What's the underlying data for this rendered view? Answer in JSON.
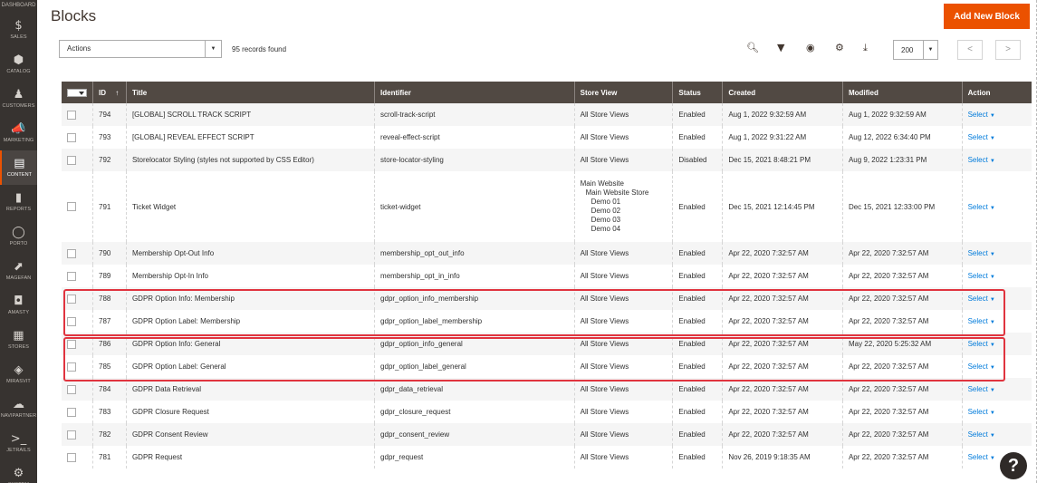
{
  "sidebar": {
    "top_label": "DASHBOARD",
    "items": [
      {
        "label": "SALES",
        "icon": "$",
        "active": false
      },
      {
        "label": "CATALOG",
        "icon": "⬢",
        "active": false
      },
      {
        "label": "CUSTOMERS",
        "icon": "♟",
        "active": false
      },
      {
        "label": "MARKETING",
        "icon": "📣",
        "active": false
      },
      {
        "label": "CONTENT",
        "icon": "▤",
        "active": true
      },
      {
        "label": "REPORTS",
        "icon": "▮",
        "active": false
      },
      {
        "label": "PORTO",
        "icon": "◯",
        "active": false
      },
      {
        "label": "MAGEFAN",
        "icon": "⬈",
        "active": false
      },
      {
        "label": "AMASTY",
        "icon": "◘",
        "active": false
      },
      {
        "label": "STORES",
        "icon": "▦",
        "active": false
      },
      {
        "label": "MIRASVIT",
        "icon": "◈",
        "active": false
      },
      {
        "label": "NAVIPARTNER",
        "icon": "☁",
        "active": false
      },
      {
        "label": "JETRAILS",
        "icon": ">_",
        "active": false
      },
      {
        "label": "SYSTEM",
        "icon": "⚙",
        "active": false
      }
    ]
  },
  "header": {
    "title": "Blocks",
    "add_button": "Add New Block"
  },
  "toolbar": {
    "actions_label": "Actions",
    "records_found": "95 records found",
    "per_page": "200"
  },
  "table": {
    "columns": [
      "ID",
      "Title",
      "Identifier",
      "Store View",
      "Status",
      "Created",
      "Modified",
      "Action"
    ],
    "sort_indicator": "↑",
    "action_label": "Select",
    "rows": [
      {
        "id": "794",
        "title": "[GLOBAL] SCROLL TRACK SCRIPT",
        "identifier": "scroll-track-script",
        "store_view": [
          "All Store Views"
        ],
        "status": "Enabled",
        "created": "Aug 1, 2022 9:32:59 AM",
        "modified": "Aug 1, 2022 9:32:59 AM"
      },
      {
        "id": "793",
        "title": "[GLOBAL] REVEAL EFFECT SCRIPT",
        "identifier": "reveal-effect-script",
        "store_view": [
          "All Store Views"
        ],
        "status": "Enabled",
        "created": "Aug 1, 2022 9:31:22 AM",
        "modified": "Aug 12, 2022 6:34:40 PM"
      },
      {
        "id": "792",
        "title": "Storelocator Styling (styles not supported by CSS Editor)",
        "identifier": "store-locator-styling",
        "store_view": [
          "All Store Views"
        ],
        "status": "Disabled",
        "created": "Dec 15, 2021 8:48:21 PM",
        "modified": "Aug 9, 2022 1:23:31 PM"
      },
      {
        "id": "791",
        "title": "Ticket Widget",
        "identifier": "ticket-widget",
        "store_view": [
          "Main Website",
          "Main Website Store",
          "Demo 01",
          "Demo 02",
          "Demo 03",
          "Demo 04"
        ],
        "status": "Enabled",
        "created": "Dec 15, 2021 12:14:45 PM",
        "modified": "Dec 15, 2021 12:33:00 PM"
      },
      {
        "id": "790",
        "title": "Membership Opt-Out Info",
        "identifier": "membership_opt_out_info",
        "store_view": [
          "All Store Views"
        ],
        "status": "Enabled",
        "created": "Apr 22, 2020 7:32:57 AM",
        "modified": "Apr 22, 2020 7:32:57 AM"
      },
      {
        "id": "789",
        "title": "Membership Opt-In Info",
        "identifier": "membership_opt_in_info",
        "store_view": [
          "All Store Views"
        ],
        "status": "Enabled",
        "created": "Apr 22, 2020 7:32:57 AM",
        "modified": "Apr 22, 2020 7:32:57 AM"
      },
      {
        "id": "788",
        "title": "GDPR Option Info: Membership",
        "identifier": "gdpr_option_info_membership",
        "store_view": [
          "All Store Views"
        ],
        "status": "Enabled",
        "created": "Apr 22, 2020 7:32:57 AM",
        "modified": "Apr 22, 2020 7:32:57 AM"
      },
      {
        "id": "787",
        "title": "GDPR Option Label: Membership",
        "identifier": "gdpr_option_label_membership",
        "store_view": [
          "All Store Views"
        ],
        "status": "Enabled",
        "created": "Apr 22, 2020 7:32:57 AM",
        "modified": "Apr 22, 2020 7:32:57 AM"
      },
      {
        "id": "786",
        "title": "GDPR Option Info: General",
        "identifier": "gdpr_option_info_general",
        "store_view": [
          "All Store Views"
        ],
        "status": "Enabled",
        "created": "Apr 22, 2020 7:32:57 AM",
        "modified": "May 22, 2020 5:25:32 AM"
      },
      {
        "id": "785",
        "title": "GDPR Option Label: General",
        "identifier": "gdpr_option_label_general",
        "store_view": [
          "All Store Views"
        ],
        "status": "Enabled",
        "created": "Apr 22, 2020 7:32:57 AM",
        "modified": "Apr 22, 2020 7:32:57 AM"
      },
      {
        "id": "784",
        "title": "GDPR Data Retrieval",
        "identifier": "gdpr_data_retrieval",
        "store_view": [
          "All Store Views"
        ],
        "status": "Enabled",
        "created": "Apr 22, 2020 7:32:57 AM",
        "modified": "Apr 22, 2020 7:32:57 AM"
      },
      {
        "id": "783",
        "title": "GDPR Closure Request",
        "identifier": "gdpr_closure_request",
        "store_view": [
          "All Store Views"
        ],
        "status": "Enabled",
        "created": "Apr 22, 2020 7:32:57 AM",
        "modified": "Apr 22, 2020 7:32:57 AM"
      },
      {
        "id": "782",
        "title": "GDPR Consent Review",
        "identifier": "gdpr_consent_review",
        "store_view": [
          "All Store Views"
        ],
        "status": "Enabled",
        "created": "Apr 22, 2020 7:32:57 AM",
        "modified": "Apr 22, 2020 7:32:57 AM"
      },
      {
        "id": "781",
        "title": "GDPR Request",
        "identifier": "gdpr_request",
        "store_view": [
          "All Store Views"
        ],
        "status": "Enabled",
        "created": "Nov 26, 2019 9:18:35 AM",
        "modified": "Apr 22, 2020 7:32:57 AM"
      }
    ]
  },
  "help_label": "?",
  "colors": {
    "accent": "#eb5100",
    "header_bg": "#514943",
    "sidebar_bg": "#373330",
    "link": "#007bdb",
    "highlight": "#e0343f"
  }
}
